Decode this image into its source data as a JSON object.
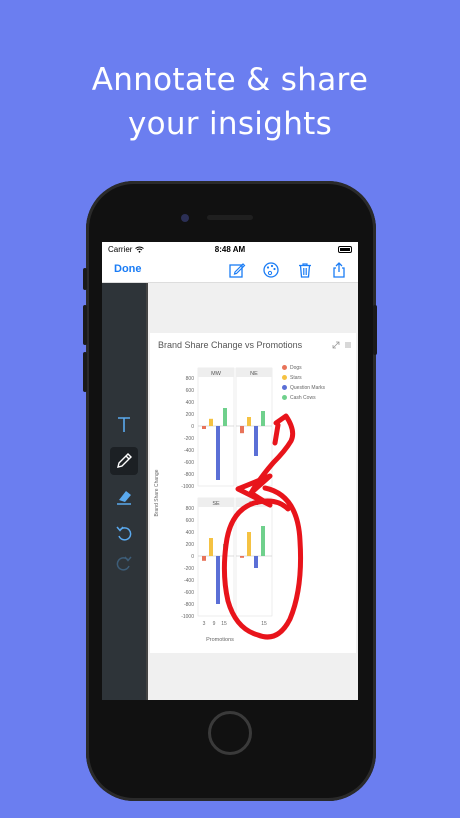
{
  "headline": {
    "line1": "Annotate & share",
    "line2": "your insights"
  },
  "status_bar": {
    "carrier": "Carrier",
    "time": "8:48 AM"
  },
  "nav": {
    "done_label": "Done"
  },
  "toolbar_icons": [
    "compose-icon",
    "palette-icon",
    "trash-icon",
    "share-icon"
  ],
  "tools": [
    {
      "name": "text-tool",
      "glyph": "T"
    },
    {
      "name": "pencil-tool",
      "glyph": "✎"
    },
    {
      "name": "eraser-tool",
      "glyph": ""
    },
    {
      "name": "undo-tool",
      "glyph": "↺"
    },
    {
      "name": "redo-tool",
      "glyph": "↻"
    }
  ],
  "colors": {
    "background": "#6b7ef0",
    "accent": "#1a7cf5",
    "annotation": "#e8141b"
  },
  "chart_data": {
    "type": "bar",
    "title": "Brand Share Change vs Promotions",
    "ylabel": "Brand Share Change",
    "xlabel": "Promotions",
    "ylim": [
      -1000,
      800
    ],
    "yticks": [
      800,
      600,
      400,
      200,
      0,
      -200,
      -400,
      -600,
      -800,
      -1000
    ],
    "xticks": [
      "3",
      "9",
      "15"
    ],
    "panels": [
      "MW",
      "NE",
      "SE",
      "WE"
    ],
    "legend": [
      {
        "name": "Dogs",
        "color": "#e8735a"
      },
      {
        "name": "Stars",
        "color": "#f5c242"
      },
      {
        "name": "Question Marks",
        "color": "#5b6fd6"
      },
      {
        "name": "Cash Cows",
        "color": "#6fd08c"
      }
    ],
    "series": [
      {
        "name": "Dogs",
        "values": [
          -50,
          -120,
          -80,
          -30
        ]
      },
      {
        "name": "Stars",
        "values": [
          120,
          150,
          300,
          400
        ]
      },
      {
        "name": "Question Marks",
        "values": [
          -900,
          -500,
          -800,
          -200
        ]
      },
      {
        "name": "Cash Cows",
        "values": [
          300,
          250,
          200,
          500
        ]
      }
    ]
  }
}
